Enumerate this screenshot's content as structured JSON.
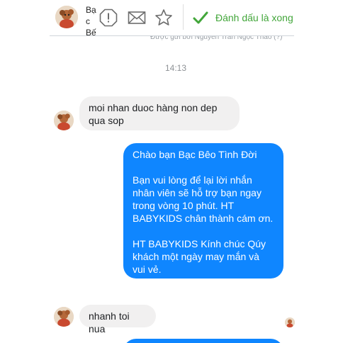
{
  "header": {
    "contact_name": "Bạc Bế",
    "alert_icon": "alert-octagon-icon",
    "mail_icon": "envelope-icon",
    "star_icon": "star-icon",
    "mark_done_label": "Đánh dấu là xong",
    "mark_done_icon": "checkmark-icon",
    "mark_done_color": "#42a63a"
  },
  "conversation": {
    "sent_by_note": "Được gửi bởi Nguyễn Trần Ngọc Thảo (?)",
    "timestamp": "14:13",
    "messages": [
      {
        "direction": "incoming",
        "text": "moi nhan duoc hàng non dep qua sop"
      },
      {
        "direction": "outgoing",
        "paragraphs": [
          "Chào bạn Bạc Bêo Tình Đời",
          "Bạn vui lòng để lại lời nhắn nhân viên sẽ hỗ trợ bạn ngay trong vòng 10 phút. HT BABYKIDS chân thành cám ơn.",
          "HT BABYKIDS Kính chúc Qúy khách một ngày may mắn và vui vẻ."
        ]
      },
      {
        "direction": "incoming",
        "text": "nhanh toi nua"
      }
    ],
    "outgoing_bubble_color": "#0f86ff",
    "incoming_bubble_color": "#f1f0f0"
  }
}
